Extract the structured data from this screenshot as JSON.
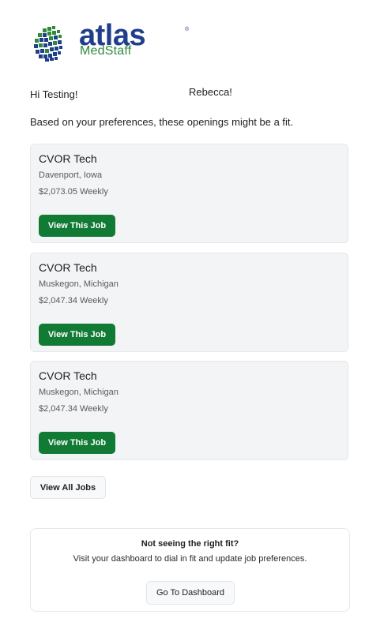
{
  "brand": {
    "name": "atlas",
    "registered": "®",
    "sub": "MedStaff",
    "primary_color": "#1f3f8a",
    "accent_color": "#2f8a3b"
  },
  "greeting": {
    "hi": "Hi Testing!",
    "name": "Rebecca!"
  },
  "intro": "Based on your preferences, these openings might be a fit.",
  "jobs": [
    {
      "title": "CVOR Tech",
      "location": "Davenport, Iowa",
      "pay": "$2,073.05 Weekly",
      "button": "View This Job"
    },
    {
      "title": "CVOR Tech",
      "location": "Muskegon, Michigan",
      "pay": "$2,047.34 Weekly",
      "button": "View This Job"
    },
    {
      "title": "CVOR Tech",
      "location": "Muskegon, Michigan",
      "pay": "$2,047.34 Weekly",
      "button": "View This Job"
    }
  ],
  "view_all": "View All Jobs",
  "promo": {
    "title": "Not seeing the right fit?",
    "text": "Visit your dashboard to dial in fit and update job preferences.",
    "button": "Go To Dashboard"
  },
  "colors": {
    "job_button": "#117a35",
    "card_bg": "#f3f4f6"
  }
}
